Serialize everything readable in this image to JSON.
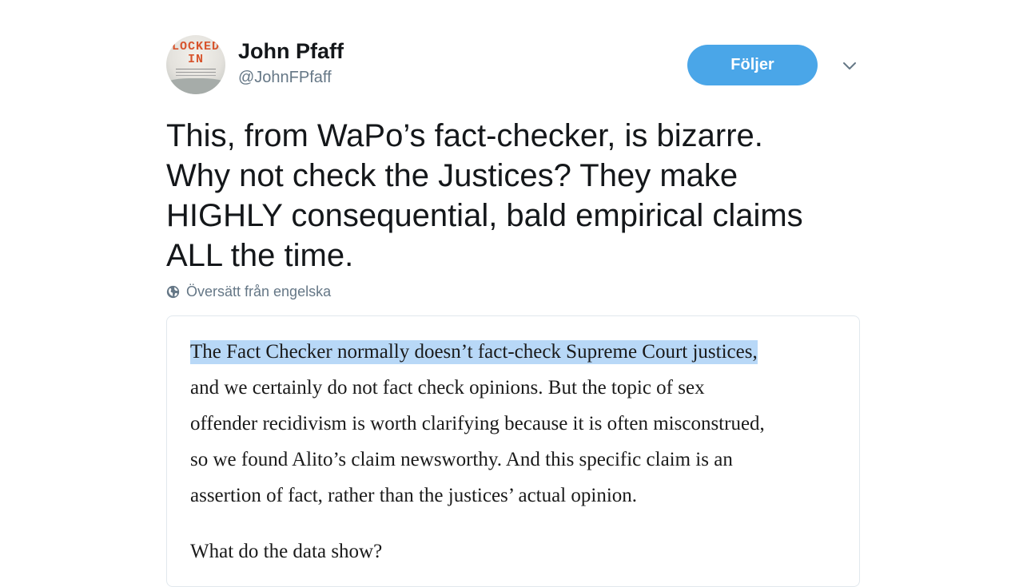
{
  "author": {
    "display_name": "John Pfaff",
    "handle": "@JohnFPfaff",
    "avatar": {
      "title_line1": "LOCKED",
      "title_line2": "IN"
    }
  },
  "follow_button": {
    "label": "Följer",
    "color": "#4aa6e8"
  },
  "menu": {
    "icon": "chevron-down-icon"
  },
  "tweet": {
    "lines": [
      "This, from WaPo’s fact-checker, is bizarre.",
      "Why not check the Justices? They make",
      "HIGHLY consequential, bald empirical claims",
      "ALL the time."
    ]
  },
  "translate": {
    "icon": "globe-icon",
    "label": "Översätt från engelska"
  },
  "quoted_image": {
    "highlighted_line": "The Fact Checker normally doesn’t fact-check Supreme Court justices,",
    "lines": [
      "and we certainly do not fact check opinions. But the topic of sex",
      "offender recidivism is worth clarifying because it is often misconstrued,",
      "so we found Alito’s claim newsworthy. And this specific claim is an",
      "assertion of fact, rather than the justices’ actual opinion."
    ],
    "question": "What do the data show?",
    "highlight_color": "#b8d8f7"
  }
}
